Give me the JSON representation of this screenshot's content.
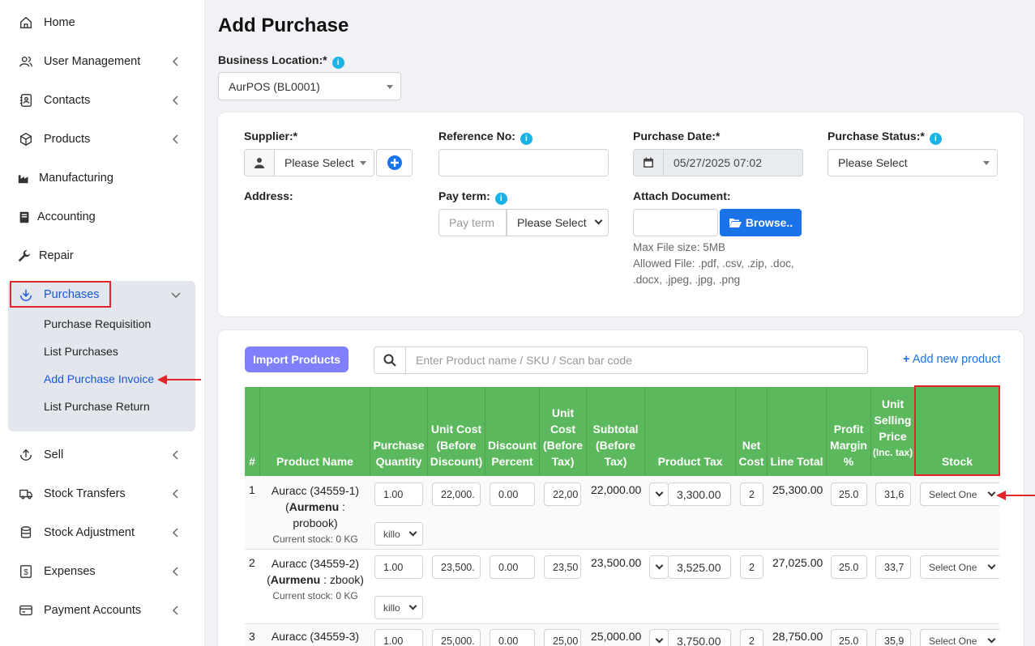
{
  "sidebar": {
    "items": [
      {
        "label": "Home",
        "icon": "home-icon"
      },
      {
        "label": "User Management",
        "icon": "users-icon"
      },
      {
        "label": "Contacts",
        "icon": "contacts-icon"
      },
      {
        "label": "Products",
        "icon": "box-icon"
      },
      {
        "label": "Manufacturing",
        "icon": "factory-icon"
      },
      {
        "label": "Accounting",
        "icon": "book-icon"
      },
      {
        "label": "Repair",
        "icon": "wrench-icon"
      },
      {
        "label": "Purchases",
        "icon": "download-icon"
      },
      {
        "label": "Sell",
        "icon": "upload-icon"
      },
      {
        "label": "Stock Transfers",
        "icon": "truck-icon"
      },
      {
        "label": "Stock Adjustment",
        "icon": "database-icon"
      },
      {
        "label": "Expenses",
        "icon": "dollar-icon"
      },
      {
        "label": "Payment Accounts",
        "icon": "card-icon"
      }
    ],
    "purchases_sub": [
      "Purchase Requisition",
      "List Purchases",
      "Add Purchase Invoice",
      "List Purchase Return"
    ],
    "accent": "#1a56db"
  },
  "page": {
    "title": "Add Purchase",
    "business_location_label": "Business Location:*",
    "business_location_value": "AurPOS (BL0001)"
  },
  "form": {
    "supplier_label": "Supplier:*",
    "supplier_placeholder": "Please Select",
    "reference_label": "Reference No:",
    "reference_value": "",
    "purchase_date_label": "Purchase Date:*",
    "purchase_date_value": "05/27/2025 07:02",
    "purchase_status_label": "Purchase Status:*",
    "purchase_status_placeholder": "Please Select",
    "address_label": "Address:",
    "pay_term_label": "Pay term:",
    "pay_term_placeholder": "Pay term",
    "pay_term_select": "Please Select",
    "attach_label": "Attach Document:",
    "browse_label": "Browse..",
    "max_file": "Max File size: 5MB",
    "allowed_file": "Allowed File: .pdf, .csv, .zip, .doc, .docx, .jpeg, .jpg, .png"
  },
  "products": {
    "import_label": "Import Products",
    "search_placeholder": "Enter Product name / SKU / Scan bar code",
    "add_new_label": "Add new product",
    "headers": [
      "#",
      "Product Name",
      "Purchase Quantity",
      "Unit Cost (Before Discount)",
      "Discount Percent",
      "Unit Cost (Before Tax)",
      "Subtotal (Before Tax)",
      "Product Tax",
      "Net Cost",
      "Line Total",
      "Profit Margin %",
      "Unit Selling Price",
      "(Inc. tax)",
      "Stock"
    ],
    "rows": [
      {
        "num": "1",
        "name_line1": "Auracc (34559-1)",
        "name_bold": "Aurmenu",
        "name_rest": " :",
        "name_line3": "probook)",
        "stock_text": "Current stock: 0 KG",
        "qty": "1.00",
        "unit": "killo",
        "unit_cost": "22,000.",
        "discount": "0.00",
        "unit_cost_bt": "22,00",
        "subtotal": "22,000.00",
        "tax": "3,300.00",
        "net_cost": "2",
        "line_total": "25,300.00",
        "margin": "25.0",
        "selling": "31,6",
        "stock_select": "Select One"
      },
      {
        "num": "2",
        "name_line1": "Auracc (34559-2)",
        "name_bold": "Aurmenu",
        "name_rest": " : zbook)",
        "name_line3": "",
        "stock_text": "Current stock: 0 KG",
        "qty": "1.00",
        "unit": "killo",
        "unit_cost": "23,500.",
        "discount": "0.00",
        "unit_cost_bt": "23,50",
        "subtotal": "23,500.00",
        "tax": "3,525.00",
        "net_cost": "2",
        "line_total": "27,025.00",
        "margin": "25.0",
        "selling": "33,7",
        "stock_select": "Select One"
      },
      {
        "num": "3",
        "name_line1": "Auracc (34559-3)",
        "name_bold": "",
        "name_rest": "",
        "name_line3": "",
        "stock_text": "",
        "qty": "1.00",
        "unit": "",
        "unit_cost": "25,000.",
        "discount": "0.00",
        "unit_cost_bt": "25,00",
        "subtotal": "25,000.00",
        "tax": "3,750.00",
        "net_cost": "2",
        "line_total": "28,750.00",
        "margin": "25.0",
        "selling": "35,9",
        "stock_select": "Select One"
      }
    ],
    "header_color": "#5cb85c"
  }
}
